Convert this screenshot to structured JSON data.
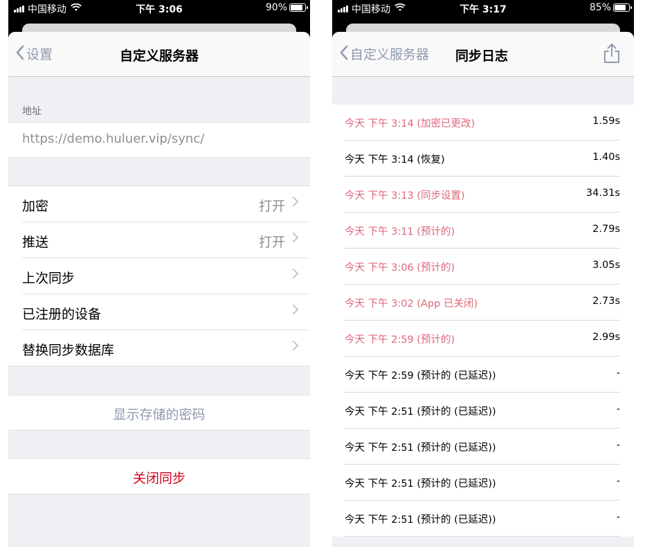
{
  "left": {
    "status": {
      "carrier": "中国移动",
      "time": "下午 3:06",
      "battery": "90%",
      "battery_level": 0.9
    },
    "nav": {
      "back_label": "设置",
      "title": "自定义服务器"
    },
    "address": {
      "header": "地址",
      "url": "https://demo.huluer.vip/sync/"
    },
    "settings": [
      {
        "label": "加密",
        "value": "打开"
      },
      {
        "label": "推送",
        "value": "打开"
      },
      {
        "label": "上次同步",
        "value": ""
      },
      {
        "label": "已注册的设备",
        "value": ""
      },
      {
        "label": "替换同步数据库",
        "value": ""
      }
    ],
    "show_password": "显示存储的密码",
    "disable_sync": "关闭同步",
    "colors": {
      "link": "#8e9aac",
      "destructive": "#d0021b"
    }
  },
  "right": {
    "status": {
      "carrier": "中国移动",
      "time": "下午 3:17",
      "battery": "85%",
      "battery_level": 0.85
    },
    "nav": {
      "back_label": "自定义服务器",
      "title": "同步日志",
      "action_icon": "share-icon"
    },
    "log": [
      {
        "time": "今天 下午 3:14",
        "note": "(加密已更改)",
        "duration": "1.59s",
        "color": "red"
      },
      {
        "time": "今天 下午 3:14",
        "note": "(恢复)",
        "duration": "1.40s",
        "color": "black"
      },
      {
        "time": "今天 下午 3:13",
        "note": "(同步设置)",
        "duration": "34.31s",
        "color": "red"
      },
      {
        "time": "今天 下午 3:11",
        "note": "(预计的)",
        "duration": "2.79s",
        "color": "red"
      },
      {
        "time": "今天 下午 3:06",
        "note": "(预计的)",
        "duration": "3.05s",
        "color": "red"
      },
      {
        "time": "今天 下午 3:02",
        "note": "(App 已关闭)",
        "duration": "2.73s",
        "color": "red"
      },
      {
        "time": "今天 下午 2:59",
        "note": "(预计的)",
        "duration": "2.99s",
        "color": "red"
      },
      {
        "time": "今天 下午 2:59",
        "note": "(预计的 (已延迟))",
        "duration": "-",
        "color": "black"
      },
      {
        "time": "今天 下午 2:51",
        "note": "(预计的 (已延迟))",
        "duration": "-",
        "color": "black"
      },
      {
        "time": "今天 下午 2:51",
        "note": "(预计的 (已延迟))",
        "duration": "-",
        "color": "black"
      },
      {
        "time": "今天 下午 2:51",
        "note": "(预计的 (已延迟))",
        "duration": "-",
        "color": "black"
      },
      {
        "time": "今天 下午 2:51",
        "note": "(预计的 (已延迟))",
        "duration": "-",
        "color": "black"
      }
    ]
  }
}
